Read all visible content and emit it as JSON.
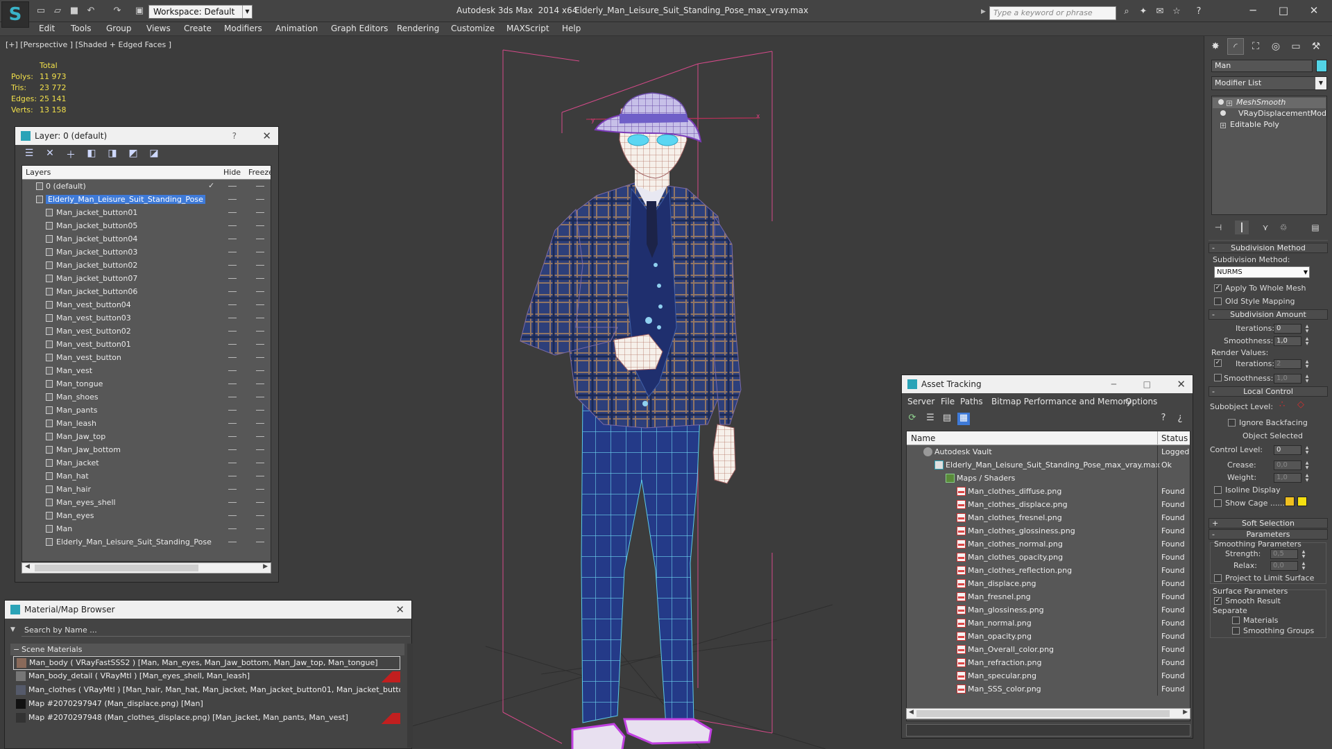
{
  "titlebar": {
    "workspace": "Workspace: Default",
    "app_title": "Autodesk 3ds Max  2014 x64",
    "file_title": "Elderly_Man_Leisure_Suit_Standing_Pose_max_vray.max",
    "search_placeholder": "Type a keyword or phrase"
  },
  "menu": [
    "Edit",
    "Tools",
    "Group",
    "Views",
    "Create",
    "Modifiers",
    "Animation",
    "Graph Editors",
    "Rendering",
    "Customize",
    "MAXScript",
    "Help"
  ],
  "viewport": {
    "label": "[+] [Perspective ] [Shaded + Edged Faces ]",
    "stats_header": "Total",
    "stats": [
      {
        "key": "Polys:",
        "value": "11 973"
      },
      {
        "key": "Tris:",
        "value": "23 772"
      },
      {
        "key": "Edges:",
        "value": "25 141"
      },
      {
        "key": "Verts:",
        "value": "13 158"
      }
    ]
  },
  "layer_window": {
    "title": "Layer: 0 (default)",
    "help": "?",
    "col_layers": "Layers",
    "col_hide": "Hide",
    "col_freeze": "Freeze",
    "rows": [
      {
        "name": "0 (default)",
        "level": 0,
        "selected": false
      },
      {
        "name": "Elderly_Man_Leisure_Suit_Standing_Pose",
        "level": 0,
        "selected": true
      },
      {
        "name": "Man_jacket_button01",
        "level": 1
      },
      {
        "name": "Man_jacket_button05",
        "level": 1
      },
      {
        "name": "Man_jacket_button04",
        "level": 1
      },
      {
        "name": "Man_jacket_button03",
        "level": 1
      },
      {
        "name": "Man_jacket_button02",
        "level": 1
      },
      {
        "name": "Man_jacket_button07",
        "level": 1
      },
      {
        "name": "Man_jacket_button06",
        "level": 1
      },
      {
        "name": "Man_vest_button04",
        "level": 1
      },
      {
        "name": "Man_vest_button03",
        "level": 1
      },
      {
        "name": "Man_vest_button02",
        "level": 1
      },
      {
        "name": "Man_vest_button01",
        "level": 1
      },
      {
        "name": "Man_vest_button",
        "level": 1
      },
      {
        "name": "Man_vest",
        "level": 1
      },
      {
        "name": "Man_tongue",
        "level": 1
      },
      {
        "name": "Man_shoes",
        "level": 1
      },
      {
        "name": "Man_pants",
        "level": 1
      },
      {
        "name": "Man_leash",
        "level": 1
      },
      {
        "name": "Man_Jaw_top",
        "level": 1
      },
      {
        "name": "Man_Jaw_bottom",
        "level": 1
      },
      {
        "name": "Man_jacket",
        "level": 1
      },
      {
        "name": "Man_hat",
        "level": 1
      },
      {
        "name": "Man_hair",
        "level": 1
      },
      {
        "name": "Man_eyes_shell",
        "level": 1
      },
      {
        "name": "Man_eyes",
        "level": 1
      },
      {
        "name": "Man",
        "level": 1
      },
      {
        "name": "Elderly_Man_Leisure_Suit_Standing_Pose",
        "level": 1
      }
    ]
  },
  "material_browser": {
    "title": "Material/Map Browser",
    "search_placeholder": "Search by Name ...",
    "group": "Scene Materials",
    "rows": [
      {
        "text": "Man_body  ( VRayFastSSS2 )  [Man, Man_eyes, Man_Jaw_bottom, Man_Jaw_top, Man_tongue]",
        "swatch": "#8a6a5a",
        "selected": true,
        "flag": false
      },
      {
        "text": "Man_body_detail  ( VRayMtl )  [Man_eyes_shell, Man_leash]",
        "swatch": "#777777",
        "selected": false,
        "flag": true
      },
      {
        "text": "Man_clothes  ( VRayMtl )  [Man_hair, Man_hat, Man_jacket, Man_jacket_button01, Man_jacket_button0...",
        "swatch": "#555a6a",
        "selected": false,
        "flag": false
      },
      {
        "text": "Map #2070297947 (Man_displace.png)  [Man]",
        "swatch": "#111111",
        "selected": false,
        "flag": false
      },
      {
        "text": "Map #2070297948 (Man_clothes_displace.png)  [Man_jacket, Man_pants, Man_vest]",
        "swatch": "#333333",
        "selected": false,
        "flag": true
      }
    ]
  },
  "asset_tracking": {
    "title": "Asset Tracking",
    "menu": [
      "Server",
      "File",
      "Paths",
      "Bitmap Performance and Memory",
      "Options"
    ],
    "col_name": "Name",
    "col_status": "Status",
    "rows": [
      {
        "name": "Autodesk Vault",
        "status": "Logged",
        "indent": 1,
        "icon": "vault"
      },
      {
        "name": "Elderly_Man_Leisure_Suit_Standing_Pose_max_vray.max",
        "status": "Ok",
        "indent": 2,
        "icon": "max"
      },
      {
        "name": "Maps / Shaders",
        "status": "",
        "indent": 3,
        "icon": "shader"
      },
      {
        "name": "Man_clothes_diffuse.png",
        "status": "Found",
        "indent": 4,
        "icon": "png"
      },
      {
        "name": "Man_clothes_displace.png",
        "status": "Found",
        "indent": 4,
        "icon": "png"
      },
      {
        "name": "Man_clothes_fresnel.png",
        "status": "Found",
        "indent": 4,
        "icon": "png"
      },
      {
        "name": "Man_clothes_glossiness.png",
        "status": "Found",
        "indent": 4,
        "icon": "png"
      },
      {
        "name": "Man_clothes_normal.png",
        "status": "Found",
        "indent": 4,
        "icon": "png"
      },
      {
        "name": "Man_clothes_opacity.png",
        "status": "Found",
        "indent": 4,
        "icon": "png"
      },
      {
        "name": "Man_clothes_reflection.png",
        "status": "Found",
        "indent": 4,
        "icon": "png"
      },
      {
        "name": "Man_displace.png",
        "status": "Found",
        "indent": 4,
        "icon": "png"
      },
      {
        "name": "Man_fresnel.png",
        "status": "Found",
        "indent": 4,
        "icon": "png"
      },
      {
        "name": "Man_glossiness.png",
        "status": "Found",
        "indent": 4,
        "icon": "png"
      },
      {
        "name": "Man_normal.png",
        "status": "Found",
        "indent": 4,
        "icon": "png"
      },
      {
        "name": "Man_opacity.png",
        "status": "Found",
        "indent": 4,
        "icon": "png"
      },
      {
        "name": "Man_Overall_color.png",
        "status": "Found",
        "indent": 4,
        "icon": "png"
      },
      {
        "name": "Man_refraction.png",
        "status": "Found",
        "indent": 4,
        "icon": "png"
      },
      {
        "name": "Man_specular.png",
        "status": "Found",
        "indent": 4,
        "icon": "png"
      },
      {
        "name": "Man_SSS_color.png",
        "status": "Found",
        "indent": 4,
        "icon": "png"
      }
    ]
  },
  "command_panel": {
    "object_name": "Man",
    "object_color": "#53d4e6",
    "modifier_list": "Modifier List",
    "stack": [
      {
        "name": "MeshSmooth",
        "selected": true
      },
      {
        "name": "VRayDisplacementMod",
        "selected": false
      },
      {
        "name": "Editable Poly",
        "selected": false
      }
    ],
    "subdivision_method": {
      "rollout": "Subdivision Method",
      "label": "Subdivision Method:",
      "value": "NURMS",
      "apply_whole_mesh": "Apply To Whole Mesh",
      "old_style_mapping": "Old Style Mapping"
    },
    "subdivision_amount": {
      "rollout": "Subdivision Amount",
      "iterations_label": "Iterations:",
      "iterations": "0",
      "smoothness_label": "Smoothness:",
      "smoothness": "1,0",
      "render_values": "Render Values:",
      "r_iterations_label": "Iterations:",
      "r_iterations": "2",
      "r_smoothness_label": "Smoothness:",
      "r_smoothness": "1,0"
    },
    "local_control": {
      "rollout": "Local Control",
      "subobject_level": "Subobject Level:",
      "ignore_backfacing": "Ignore Backfacing",
      "object_selected": "Object Selected",
      "control_level_label": "Control Level:",
      "control_level": "0",
      "crease_label": "Crease:",
      "crease": "0,0",
      "weight_label": "Weight:",
      "weight": "1,0",
      "isoline_display": "Isoline Display",
      "show_cage": "Show Cage ......",
      "cage_color1": "#f0c020",
      "cage_color2": "#f5e010"
    },
    "soft_selection": "Soft Selection",
    "parameters": {
      "rollout": "Parameters",
      "smoothing_params": "Smoothing Parameters",
      "strength_label": "Strength:",
      "strength": "0,5",
      "relax_label": "Relax:",
      "relax": "0,0",
      "project_limit": "Project to Limit Surface",
      "surface_params": "Surface Parameters",
      "smooth_result": "Smooth Result",
      "separate": "Separate",
      "materials": "Materials",
      "smoothing_groups": "Smoothing Groups"
    }
  }
}
